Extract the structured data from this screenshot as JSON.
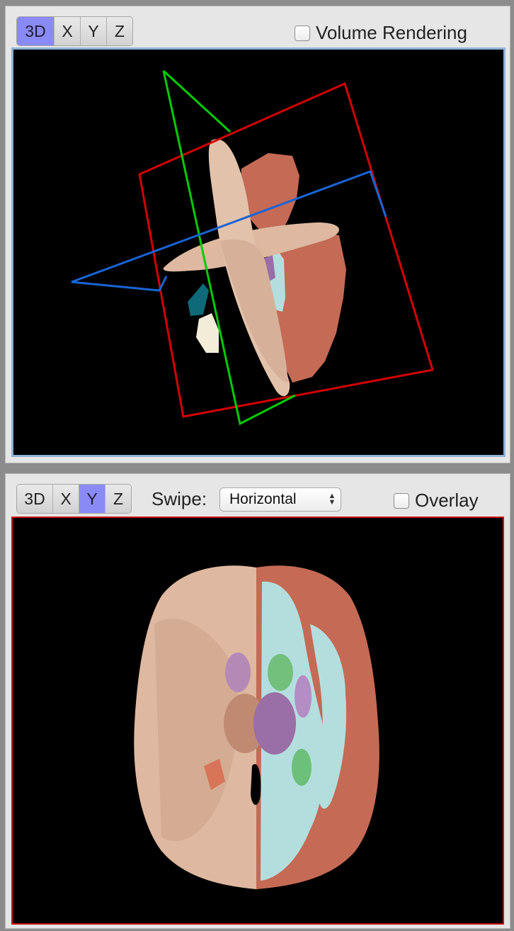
{
  "top_panel": {
    "view_buttons": [
      {
        "label": "3D",
        "active": true
      },
      {
        "label": "X",
        "active": false
      },
      {
        "label": "Y",
        "active": false
      },
      {
        "label": "Z",
        "active": false
      }
    ],
    "volume_rendering": {
      "label": "Volume Rendering",
      "checked": false
    },
    "viewport": {
      "mode": "3D",
      "border_color": "#8fb1d6",
      "plane_colors": {
        "x": "#d40000",
        "y": "#00cc00",
        "z": "#1a64d6"
      }
    }
  },
  "bottom_panel": {
    "view_buttons": [
      {
        "label": "3D",
        "active": false
      },
      {
        "label": "X",
        "active": false
      },
      {
        "label": "Y",
        "active": true
      },
      {
        "label": "Z",
        "active": false
      }
    ],
    "swipe": {
      "label": "Swipe:",
      "value": "Horizontal"
    },
    "overlay": {
      "label": "Overlay",
      "checked": false
    },
    "viewport": {
      "mode": "Y",
      "border_color": "#c81414"
    }
  },
  "colors": {
    "active_button": "#8a8af7",
    "tissue_beige": "#deb8a0",
    "tissue_terracotta": "#c46a55",
    "tissue_lightblue": "#b4dede",
    "structure_purple": "#9a6ea6",
    "structure_green": "#6cc07a"
  }
}
